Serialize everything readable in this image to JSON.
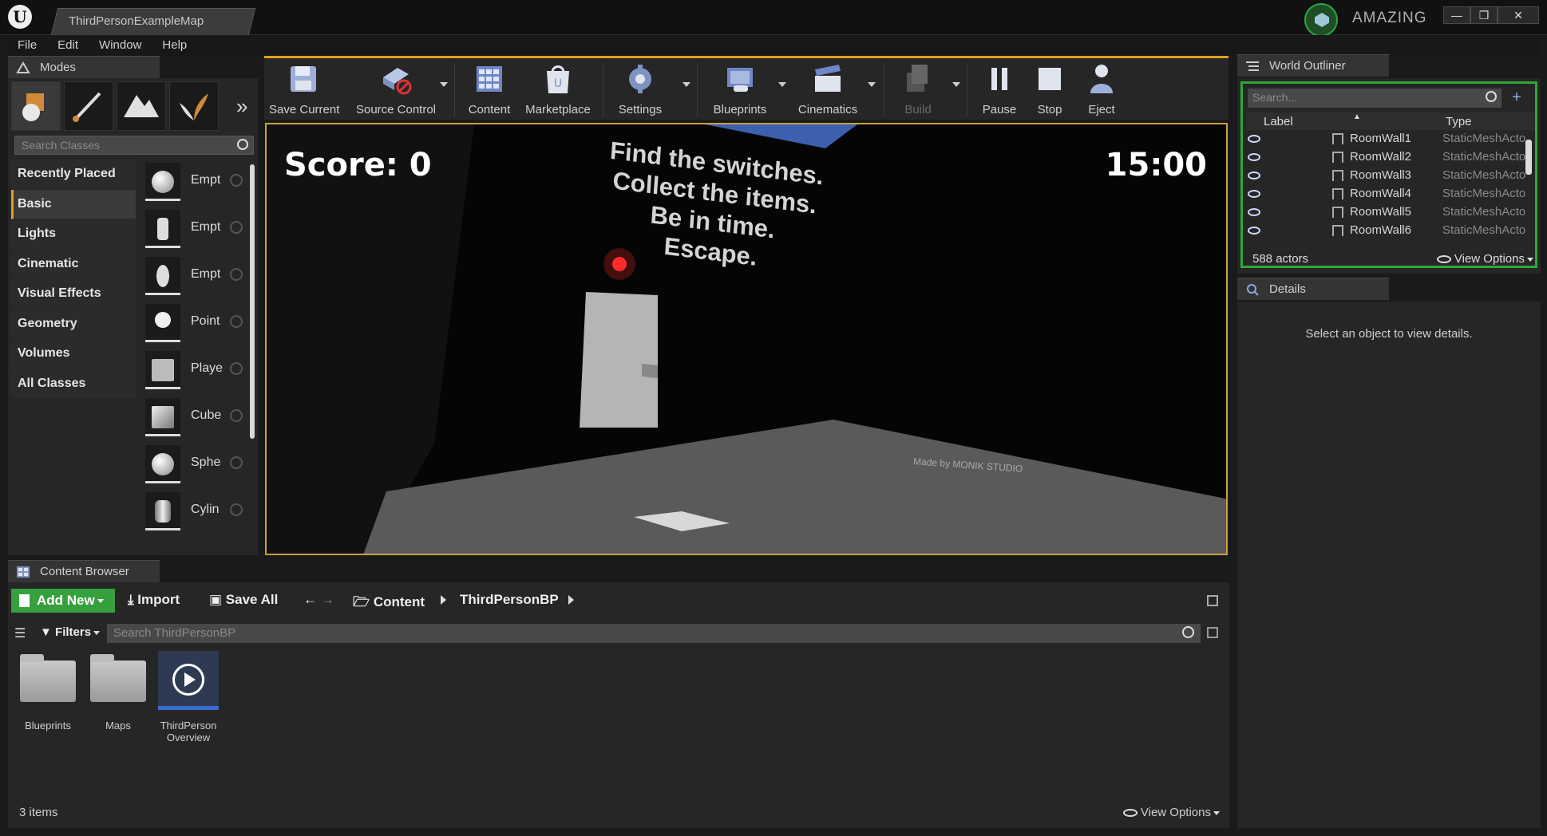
{
  "window": {
    "tab_title": "ThirdPersonExampleMap",
    "user_label": "AMAZING",
    "min_glyph": "—",
    "max_glyph": "❐",
    "close_glyph": "✕"
  },
  "menu": [
    "File",
    "Edit",
    "Window",
    "Help"
  ],
  "modes": {
    "tab_label": "Modes",
    "more_glyph": "»",
    "search_placeholder": "Search Classes",
    "categories": [
      "Recently Placed",
      "Basic",
      "Lights",
      "Cinematic",
      "Visual Effects",
      "Geometry",
      "Volumes",
      "All Classes"
    ],
    "active_category": "Basic",
    "items": [
      "Empt",
      "Empt",
      "Empt",
      "Point",
      "Playe",
      "Cube",
      "Sphe",
      "Cylin"
    ]
  },
  "toolbar": {
    "save_current": "Save Current",
    "source_control": "Source Control",
    "content": "Content",
    "marketplace": "Marketplace",
    "settings": "Settings",
    "blueprints": "Blueprints",
    "cinematics": "Cinematics",
    "build": "Build",
    "pause": "Pause",
    "stop": "Stop",
    "eject": "Eject"
  },
  "viewport": {
    "score": "Score: 0",
    "timer": "15:00",
    "message_lines": [
      "Find the switches.",
      "Collect the items.",
      "Be in time.",
      "Escape."
    ],
    "credit": "Made by MONIK STUDIO"
  },
  "outliner": {
    "tab_label": "World Outliner",
    "search_placeholder": "Search...",
    "col_label": "Label",
    "col_type": "Type",
    "rows": [
      {
        "name": "RoomWall1",
        "type": "StaticMeshActor"
      },
      {
        "name": "RoomWall2",
        "type": "StaticMeshActor"
      },
      {
        "name": "RoomWall3",
        "type": "StaticMeshActor"
      },
      {
        "name": "RoomWall4",
        "type": "StaticMeshActor"
      },
      {
        "name": "RoomWall5",
        "type": "StaticMeshActor"
      },
      {
        "name": "RoomWall6",
        "type": "StaticMeshActor"
      }
    ],
    "actor_count": "588 actors",
    "view_options": "View Options"
  },
  "details": {
    "tab_label": "Details",
    "empty_message": "Select an object to view details."
  },
  "content_browser": {
    "tab_label": "Content Browser",
    "add_new": "Add New",
    "import": "Import",
    "save_all": "Save All",
    "path": [
      "Content",
      "ThirdPersonBP"
    ],
    "filters": "Filters",
    "search_placeholder": "Search ThirdPersonBP",
    "assets": [
      {
        "name": "Blueprints",
        "kind": "folder"
      },
      {
        "name": "Maps",
        "kind": "folder"
      },
      {
        "name": "ThirdPerson Overview",
        "kind": "asset"
      }
    ],
    "item_count": "3 items",
    "view_options": "View Options"
  },
  "colors": {
    "accent_green": "#37a03e",
    "selection_gold": "#c8a040",
    "outliner_highlight": "#2fa839"
  }
}
